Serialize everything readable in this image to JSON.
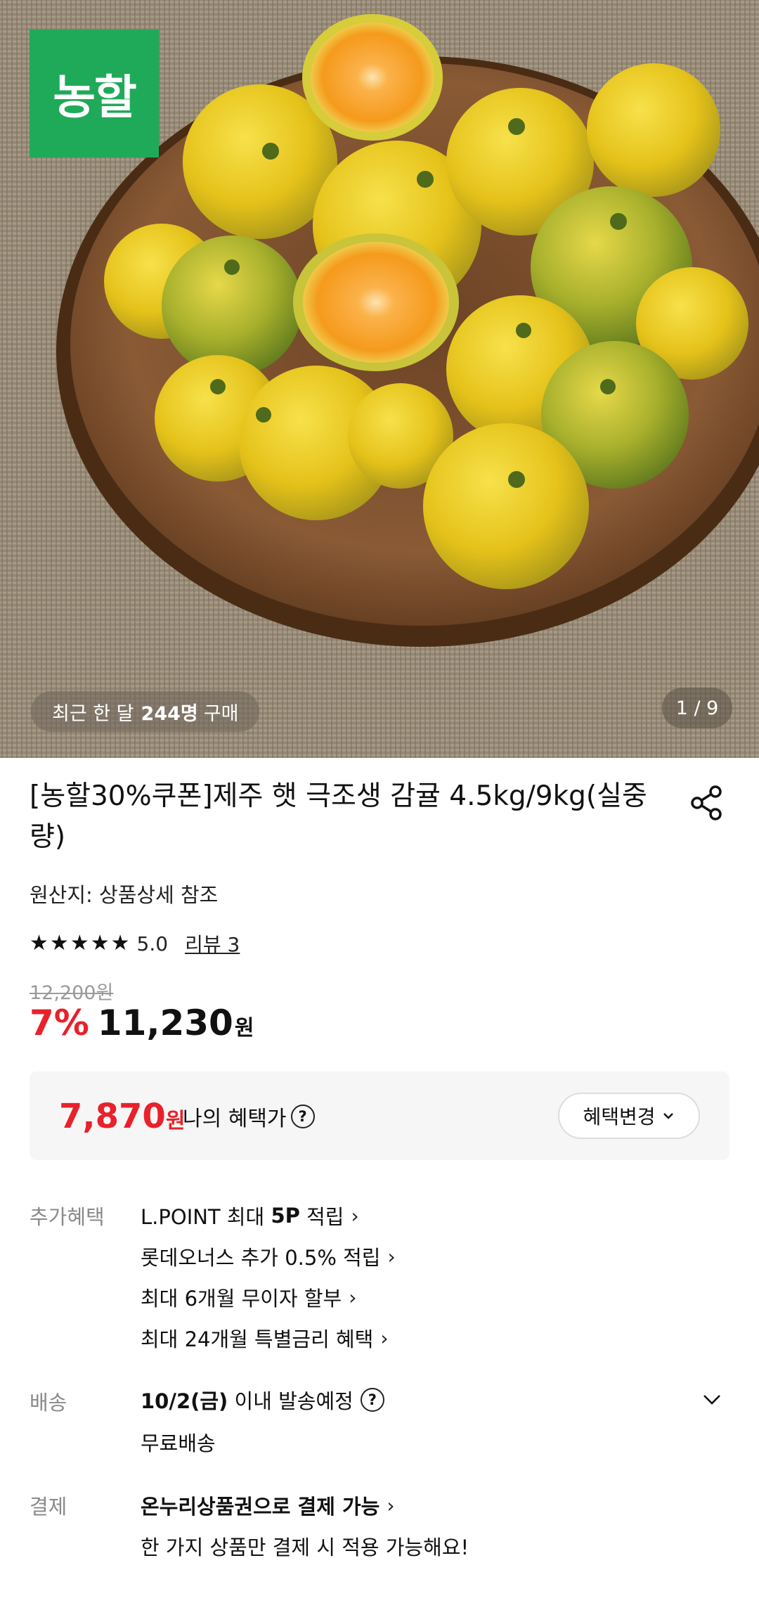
{
  "hero": {
    "brand_logo_text": "농할",
    "purchase_badge": {
      "prefix": "최근 한 달",
      "count": "244명",
      "suffix": "구매"
    },
    "page_indicator": "1 / 9"
  },
  "product": {
    "title": "[농할30%쿠폰]제주 햇 극조생 감귤 4.5kg/9kg(실중량)",
    "origin": "원산지: 상품상세 참조",
    "stars": 5,
    "rating": "5.0",
    "review_link": "리뷰 3",
    "original_price": "12,200원",
    "discount": "7%",
    "price": "11,230",
    "price_unit": "원"
  },
  "benefit": {
    "price": "7,870",
    "unit": "원",
    "label": "나의 혜택가",
    "help_icon": "?",
    "change_button": "혜택변경"
  },
  "extra": {
    "label": "추가혜택",
    "items": [
      {
        "pre": "L.POINT 최대 ",
        "bold": "5P",
        "post": " 적립"
      },
      {
        "pre": "롯데오너스 추가 0.5% 적립",
        "bold": "",
        "post": ""
      },
      {
        "pre": "최대 6개월 무이자 할부",
        "bold": "",
        "post": ""
      },
      {
        "pre": "최대 24개월 특별금리 혜택",
        "bold": "",
        "post": ""
      }
    ]
  },
  "shipping": {
    "label": "배송",
    "date": "10/2(금)",
    "date_suffix": " 이내 발송예정",
    "help_icon": "?",
    "fee": "무료배송"
  },
  "payment": {
    "label": "결제",
    "method": "온누리상품권으로 결제 가능",
    "note": "한 가지 상품만 결제 시 적용 가능해요!"
  },
  "colors": {
    "brand_green": "#1faa59",
    "discount_red": "#e8212b",
    "benefit_box_bg": "#f6f6f6",
    "muted_text": "#8a8a8a"
  },
  "icons": [
    "share-icon",
    "help-circle-icon",
    "chevron-down-icon",
    "chevron-right-icon",
    "star-icon"
  ]
}
